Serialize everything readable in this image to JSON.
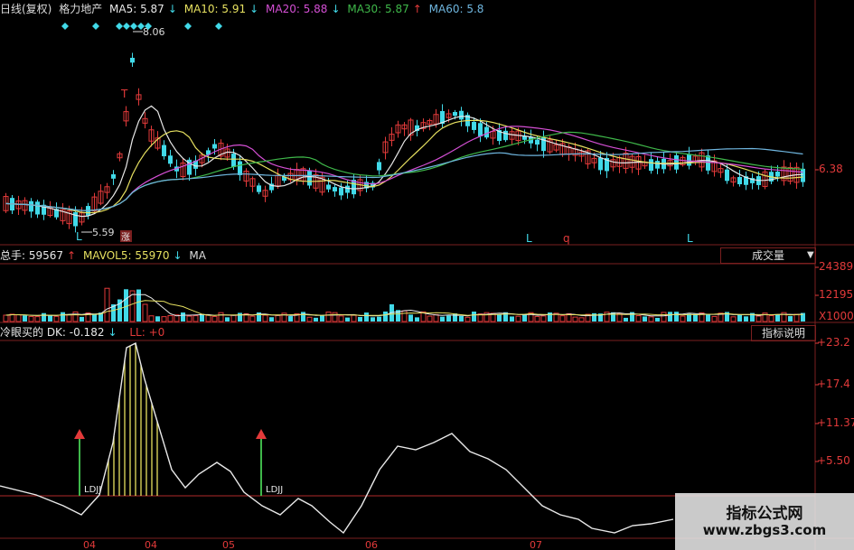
{
  "colors": {
    "up": "#e23a3a",
    "down": "#41d9e8",
    "ma5": "#e8e8e8",
    "ma10": "#e6e060",
    "ma20": "#d44fd4",
    "ma30": "#3fb84a",
    "ma60": "#6fb6df",
    "label": "#dcdcdc",
    "border": "#7a1f1f"
  },
  "price_legend": {
    "title": "日线(复权)",
    "stock": "格力地产",
    "ma5": "MA5: 5.87",
    "ma5_arrow": "↓",
    "ma10": "MA10: 5.91",
    "ma10_arrow": "↓",
    "ma20": "MA20: 5.88",
    "ma20_arrow": "↓",
    "ma30": "MA30: 5.87",
    "ma30_arrow": "↑",
    "ma60": "MA60: 5.8"
  },
  "price_axis": {
    "label": "6.38"
  },
  "price_annotations": {
    "high": "8.06",
    "low": "5.59",
    "t_mark": "T",
    "rise_mark": "涨",
    "markers": [
      "L",
      "q",
      "L"
    ]
  },
  "volume_legend": {
    "total": "总手: 59567",
    "total_arrow": "↑",
    "mavol5": "MAVOL5: 55970",
    "mavol5_arrow": "↓",
    "extra": "MA"
  },
  "volume_button": "成交量",
  "volume_axis": [
    "24389",
    "12195",
    "X1000"
  ],
  "indicator_legend": {
    "name": "冷眼买的 DK: -0.182",
    "name_arrow": "↓",
    "ll": "LL: +0"
  },
  "indicator_button": "指标说明",
  "indicator_axis": [
    "+23.2",
    "+17.4",
    "+11.37",
    "+5.50"
  ],
  "signal_labels": [
    "LDJJ",
    "LDJJ"
  ],
  "date_labels": [
    "04",
    "04",
    "05",
    "06",
    "07"
  ],
  "watermark": {
    "title": "指标公式网",
    "url": "www.zbgs3.com"
  }
}
